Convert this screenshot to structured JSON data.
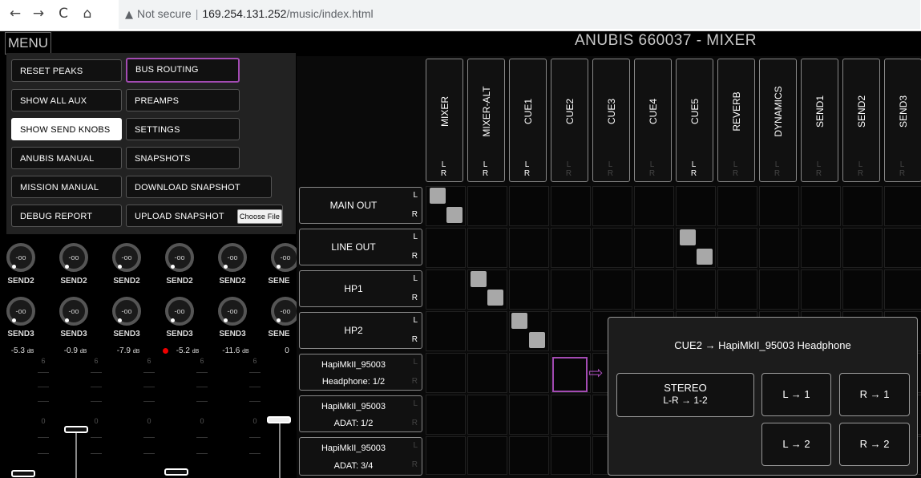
{
  "browser": {
    "back": "←",
    "forward": "→",
    "reload": "C",
    "home": "⌂",
    "warning_icon": "▲",
    "not_secure": "Not secure",
    "host": "169.254.131.252",
    "path": "/music/index.html"
  },
  "header": {
    "menu_label": "MENU",
    "title": "ANUBIS 660037 - MIXER"
  },
  "menu": {
    "col1": [
      "RESET PEAKS",
      "SHOW ALL AUX",
      "SHOW SEND KNOBS",
      "ANUBIS MANUAL",
      "MISSION MANUAL",
      "DEBUG REPORT"
    ],
    "col2": [
      "BUS ROUTING",
      "PREAMPS",
      "SETTINGS",
      "SNAPSHOTS",
      "DOWNLOAD SNAPSHOT",
      "UPLOAD SNAPSHOT"
    ],
    "choose_file": "Choose File"
  },
  "strips": {
    "knob_value": "-oo",
    "send2_label": "SEND2",
    "send3_label": "SEND3",
    "send_partial": "SENE",
    "levels": [
      "-5.3",
      "-0.9",
      "-7.9",
      "-5.2",
      "-11.6",
      "0"
    ],
    "db_unit": "dB",
    "scale_6": "6",
    "scale_0": "0"
  },
  "matrix": {
    "columns": [
      "MIXER",
      "MIXER-ALT",
      "CUE1",
      "CUE2",
      "CUE3",
      "CUE4",
      "CUE5",
      "REVERB",
      "DYNAMICS",
      "SEND1",
      "SEND2",
      "SEND3"
    ],
    "lr_label": "L R",
    "rows": [
      {
        "line1": "MAIN OUT",
        "line2": ""
      },
      {
        "line1": "LINE OUT",
        "line2": ""
      },
      {
        "line1": "HP1",
        "line2": ""
      },
      {
        "line1": "HP2",
        "line2": ""
      },
      {
        "line1": "HapiMkII_95003",
        "line2": "Headphone: 1/2"
      },
      {
        "line1": "HapiMkII_95003",
        "line2": "ADAT: 1/2"
      },
      {
        "line1": "HapiMkII_95003",
        "line2": "ADAT: 3/4"
      }
    ],
    "l": "L",
    "r": "R",
    "arrow": "⇨"
  },
  "popup": {
    "title": "CUE2 → HapiMkII_95003 Headphone",
    "stereo_line1": "STEREO",
    "stereo_line2": "L-R → 1-2",
    "l1": "L → 1",
    "r1": "R → 1",
    "l2": "L → 2",
    "r2": "R → 2"
  },
  "colors": {
    "accent": "#a34bb3",
    "point": "#a8a8a8",
    "peak": "#e00000"
  }
}
